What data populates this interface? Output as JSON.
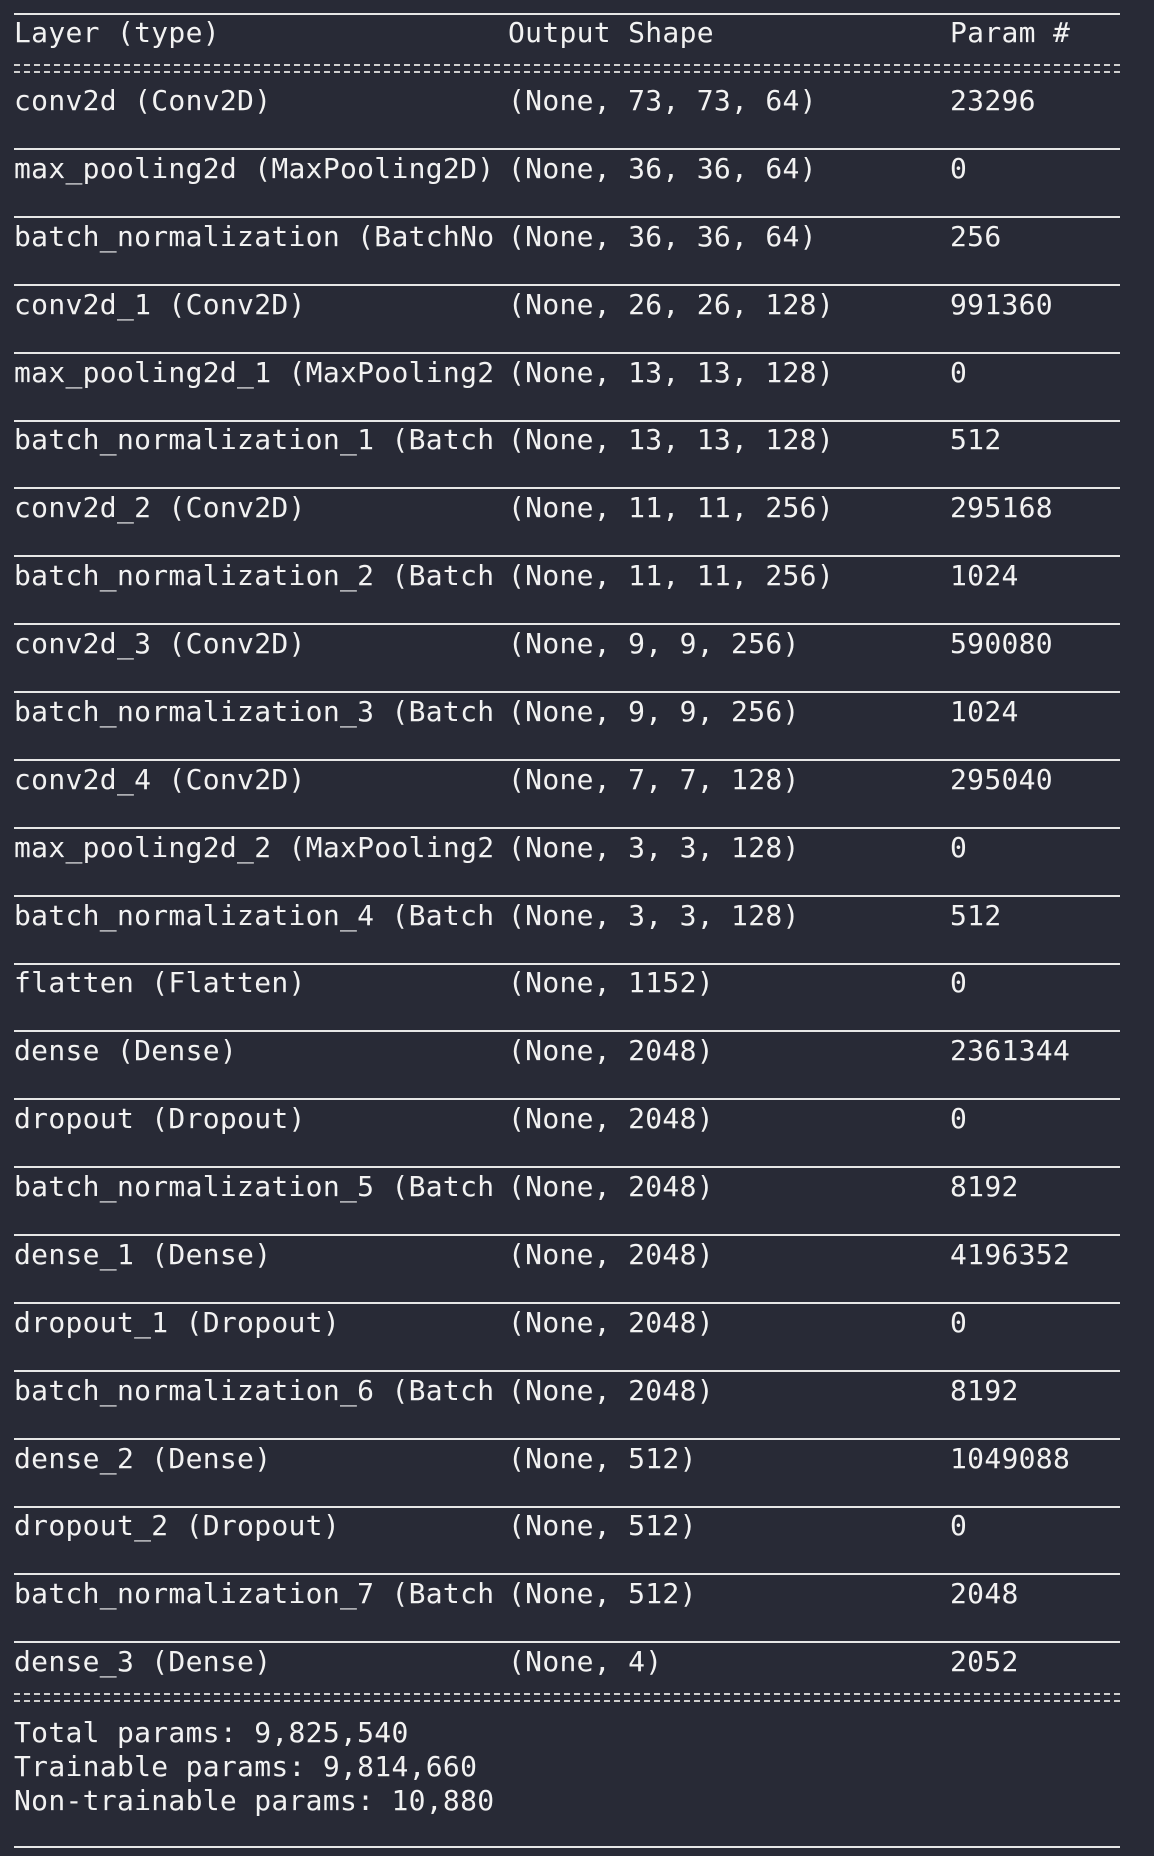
{
  "header": {
    "layer": "Layer (type)",
    "shape": "Output Shape",
    "param": "Param #"
  },
  "rows": [
    {
      "layer": "conv2d (Conv2D)",
      "shape": "(None, 73, 73, 64)",
      "param": "23296"
    },
    {
      "layer": "max_pooling2d (MaxPooling2D)",
      "shape": "(None, 36, 36, 64)",
      "param": "0"
    },
    {
      "layer": "batch_normalization (BatchNo",
      "shape": "(None, 36, 36, 64)",
      "param": "256"
    },
    {
      "layer": "conv2d_1 (Conv2D)",
      "shape": "(None, 26, 26, 128)",
      "param": "991360"
    },
    {
      "layer": "max_pooling2d_1 (MaxPooling2",
      "shape": "(None, 13, 13, 128)",
      "param": "0"
    },
    {
      "layer": "batch_normalization_1 (Batch",
      "shape": "(None, 13, 13, 128)",
      "param": "512"
    },
    {
      "layer": "conv2d_2 (Conv2D)",
      "shape": "(None, 11, 11, 256)",
      "param": "295168"
    },
    {
      "layer": "batch_normalization_2 (Batch",
      "shape": "(None, 11, 11, 256)",
      "param": "1024"
    },
    {
      "layer": "conv2d_3 (Conv2D)",
      "shape": "(None, 9, 9, 256)",
      "param": "590080"
    },
    {
      "layer": "batch_normalization_3 (Batch",
      "shape": "(None, 9, 9, 256)",
      "param": "1024"
    },
    {
      "layer": "conv2d_4 (Conv2D)",
      "shape": "(None, 7, 7, 128)",
      "param": "295040"
    },
    {
      "layer": "max_pooling2d_2 (MaxPooling2",
      "shape": "(None, 3, 3, 128)",
      "param": "0"
    },
    {
      "layer": "batch_normalization_4 (Batch",
      "shape": "(None, 3, 3, 128)",
      "param": "512"
    },
    {
      "layer": "flatten (Flatten)",
      "shape": "(None, 1152)",
      "param": "0"
    },
    {
      "layer": "dense (Dense)",
      "shape": "(None, 2048)",
      "param": "2361344"
    },
    {
      "layer": "dropout (Dropout)",
      "shape": "(None, 2048)",
      "param": "0"
    },
    {
      "layer": "batch_normalization_5 (Batch",
      "shape": "(None, 2048)",
      "param": "8192"
    },
    {
      "layer": "dense_1 (Dense)",
      "shape": "(None, 2048)",
      "param": "4196352"
    },
    {
      "layer": "dropout_1 (Dropout)",
      "shape": "(None, 2048)",
      "param": "0"
    },
    {
      "layer": "batch_normalization_6 (Batch",
      "shape": "(None, 2048)",
      "param": "8192"
    },
    {
      "layer": "dense_2 (Dense)",
      "shape": "(None, 512)",
      "param": "1049088"
    },
    {
      "layer": "dropout_2 (Dropout)",
      "shape": "(None, 512)",
      "param": "0"
    },
    {
      "layer": "batch_normalization_7 (Batch",
      "shape": "(None, 512)",
      "param": "2048"
    },
    {
      "layer": "dense_3 (Dense)",
      "shape": "(None, 4)",
      "param": "2052"
    }
  ],
  "totals": {
    "total": "Total params: 9,825,540",
    "trainable": "Trainable params: 9,814,660",
    "non_trainable": "Non-trainable params: 10,880"
  }
}
